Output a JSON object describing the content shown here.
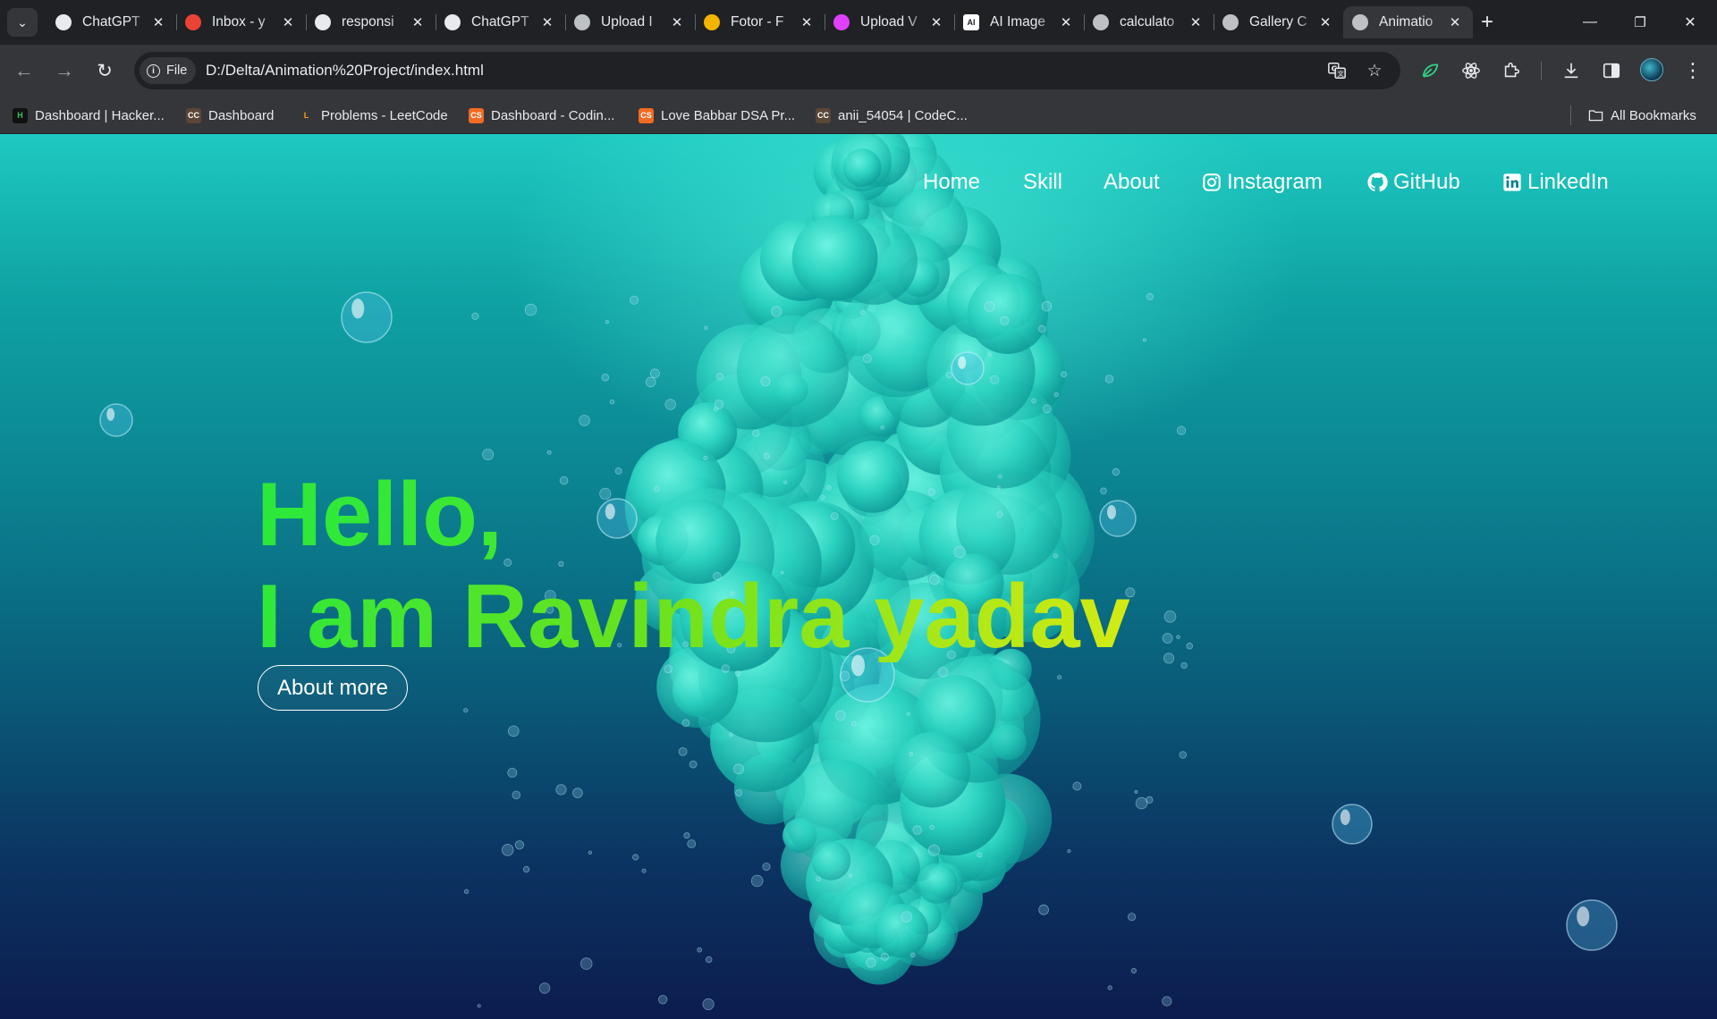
{
  "browser": {
    "tabs": [
      {
        "title": "ChatGPT",
        "icon": "chatgpt-icon",
        "color": "#e8eaed"
      },
      {
        "title": "Inbox - y",
        "icon": "gmail-icon",
        "color": "#ea4335"
      },
      {
        "title": "responsi",
        "icon": "github-icon",
        "color": "#e8eaed"
      },
      {
        "title": "ChatGPT",
        "icon": "chatgpt-icon",
        "color": "#e8eaed"
      },
      {
        "title": "Upload I",
        "icon": "layers-icon",
        "color": "#bdc1c6"
      },
      {
        "title": "Fotor - F",
        "icon": "fotor-icon",
        "color": "#f4b400"
      },
      {
        "title": "Upload V",
        "icon": "upload-app-icon",
        "color": "#e040fb"
      },
      {
        "title": "AI Image",
        "icon": "ai-logo-icon",
        "color": "#ffffff"
      },
      {
        "title": "calculato",
        "icon": "globe-icon",
        "color": "#bdc1c6"
      },
      {
        "title": "Gallery C",
        "icon": "globe-icon",
        "color": "#bdc1c6"
      },
      {
        "title": "Animatio",
        "icon": "globe-icon",
        "color": "#bdc1c6",
        "active": true
      }
    ],
    "new_tab": "+",
    "window_controls": {
      "minimize": "—",
      "restore": "❐",
      "close": "✕"
    }
  },
  "toolbar": {
    "file_chip": "File",
    "url": "D:/Delta/Animation%20Project/index.html"
  },
  "bookmarks": {
    "items": [
      {
        "label": "Dashboard | Hacker...",
        "icon_text": "H",
        "bg": "#111111",
        "fg": "#2ec866"
      },
      {
        "label": "Dashboard",
        "icon_text": "CC",
        "bg": "#5b4636",
        "fg": "#ffffff"
      },
      {
        "label": "Problems - LeetCode",
        "icon_text": "L",
        "bg": "transparent",
        "fg": "#ffa116"
      },
      {
        "label": "Dashboard - Codin...",
        "icon_text": "CS",
        "bg": "#f26b22",
        "fg": "#ffffff"
      },
      {
        "label": "Love Babbar DSA Pr...",
        "icon_text": "CS",
        "bg": "#f26b22",
        "fg": "#ffffff"
      },
      {
        "label": "anii_54054 | CodeC...",
        "icon_text": "CC",
        "bg": "#5b4636",
        "fg": "#ffffff"
      }
    ],
    "all_bookmarks": "All Bookmarks"
  },
  "page": {
    "nav": {
      "home": "Home",
      "skill": "Skill",
      "about": "About",
      "instagram": "Instagram",
      "github": "GitHub",
      "linkedin": "LinkedIn"
    },
    "hero": {
      "line1": "Hello,",
      "line2": "I am Ravindra yadav",
      "button": "About more"
    },
    "colors": {
      "accent_green": "#2fe83a",
      "accent_yellow": "#d4ea13",
      "smoke": "#2fd8c3"
    }
  }
}
